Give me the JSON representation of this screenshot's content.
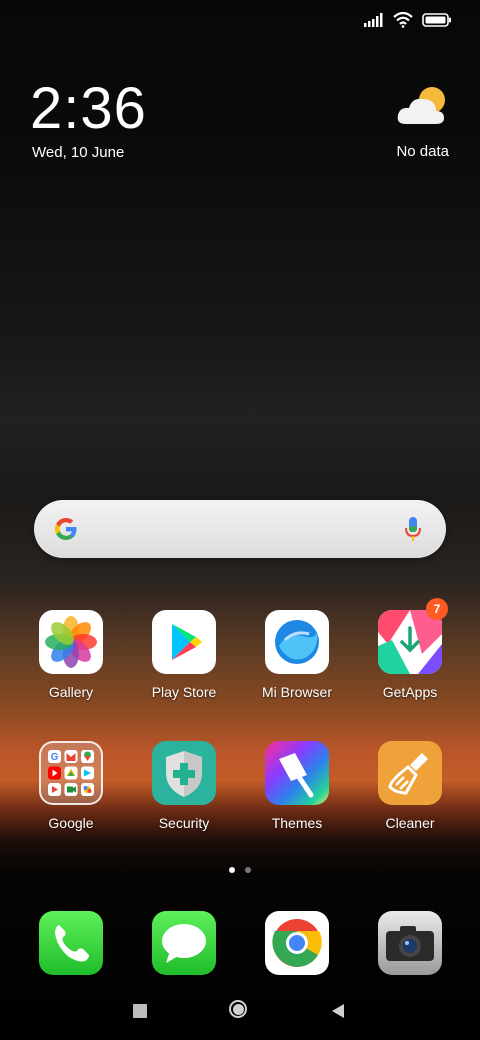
{
  "clock": {
    "time": "2:36",
    "date": "Wed, 10 June"
  },
  "weather": {
    "icon": "partly-cloudy-icon",
    "text": "No data"
  },
  "status": {
    "signal": "signal-icon",
    "wifi": "wifi-icon",
    "battery": "battery-icon"
  },
  "search": {
    "logo": "google-g-icon",
    "mic": "mic-icon"
  },
  "apps_row1": [
    {
      "label": "Gallery",
      "icon": "gallery-icon"
    },
    {
      "label": "Play Store",
      "icon": "play-store-icon"
    },
    {
      "label": "Mi Browser",
      "icon": "mi-browser-icon"
    },
    {
      "label": "GetApps",
      "icon": "getapps-icon",
      "badge": "7"
    }
  ],
  "apps_row2": [
    {
      "label": "Google",
      "icon": "google-folder-icon"
    },
    {
      "label": "Security",
      "icon": "security-icon"
    },
    {
      "label": "Themes",
      "icon": "themes-icon"
    },
    {
      "label": "Cleaner",
      "icon": "cleaner-icon"
    }
  ],
  "page_indicator": {
    "pages": 2,
    "active": 1
  },
  "dock": [
    {
      "icon": "phone-icon"
    },
    {
      "icon": "messages-icon"
    },
    {
      "icon": "chrome-icon"
    },
    {
      "icon": "camera-icon"
    }
  ],
  "navbar": {
    "recents": "square-icon",
    "home": "circle-icon",
    "back": "triangle-back-icon"
  }
}
